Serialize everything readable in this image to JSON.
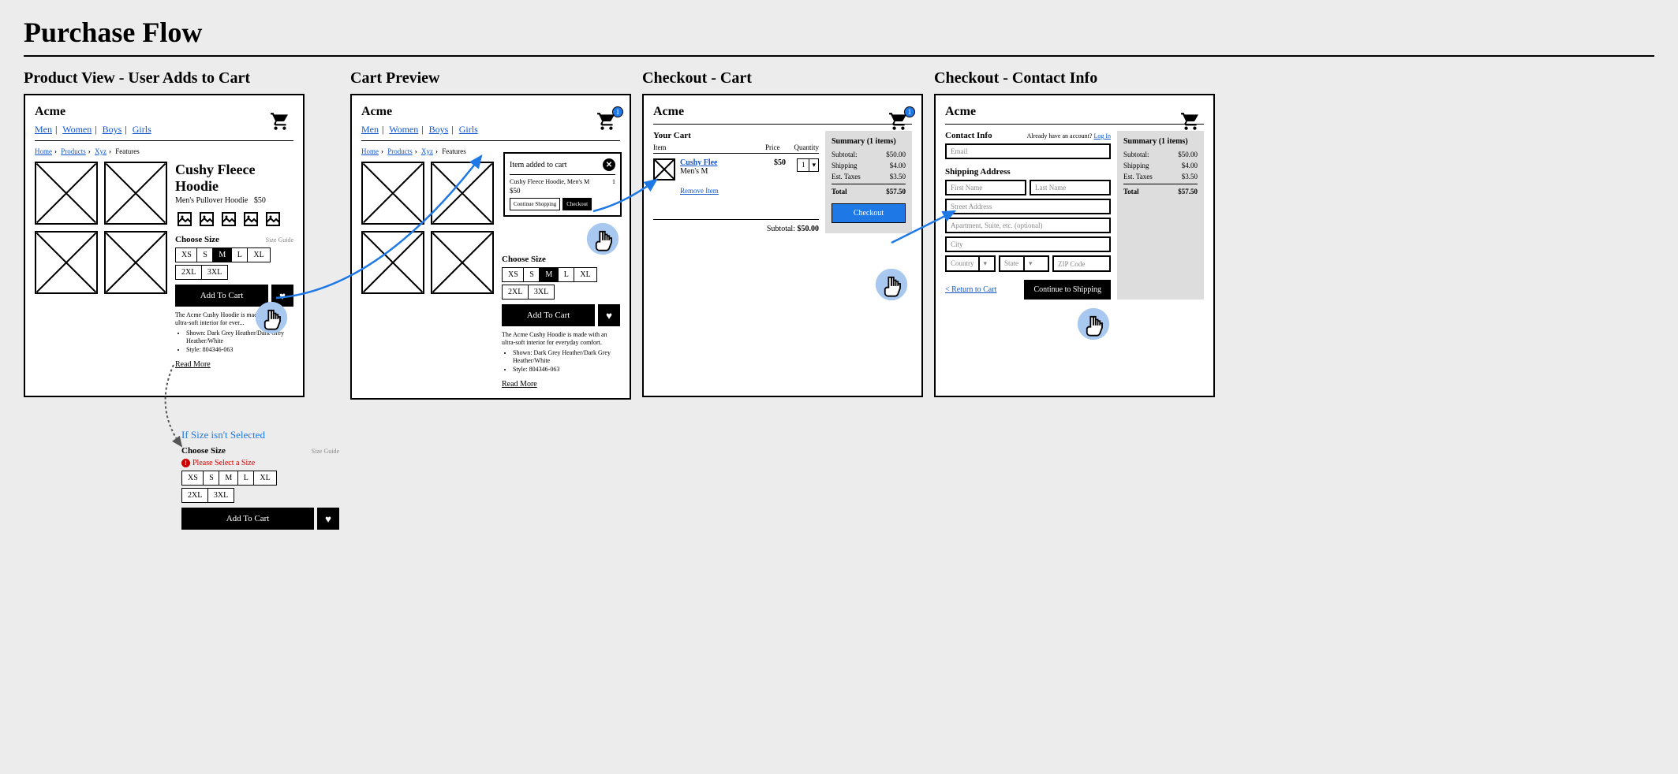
{
  "page_title": "Purchase Flow",
  "panels": {
    "p1": {
      "title": "Product View - User Adds to Cart"
    },
    "p2": {
      "title": "Cart Preview"
    },
    "p3": {
      "title": "Checkout - Cart"
    },
    "p4": {
      "title": "Checkout - Contact Info"
    }
  },
  "brand": "Acme",
  "nav": {
    "men": "Men",
    "women": "Women",
    "boys": "Boys",
    "girls": "Girls"
  },
  "crumbs": {
    "home": "Home",
    "products": "Products",
    "xyz": "Xyz",
    "features": "Features"
  },
  "product": {
    "name": "Cushy Fleece Hoodie",
    "sub": "Men's Pullover Hoodie",
    "price": "$50",
    "choose_size": "Choose Size",
    "size_guide": "Size Guide",
    "sizes": {
      "xs": "XS",
      "s": "S",
      "m": "M",
      "l": "L",
      "xl": "XL",
      "xxl": "2XL",
      "xxxl": "3XL"
    },
    "add_to_cart": "Add To Cart",
    "desc": "The Acme Cushy Hoodie is made with an ultra-soft interior for everyday comfort.",
    "desc_trunc": "The Acme Cushy Hoodie is made with an ultra-soft interior for ever...",
    "bullet1": "Shown: Dark Grey Heather/Dark Grey Heather/White",
    "bullet2": "Style: 804346-063",
    "read_more": "Read More"
  },
  "popover": {
    "title": "Item added to cart",
    "item": "Cushy Fleece Hoodie, Men's M",
    "price": "$50",
    "qty": "1",
    "continue": "Continue Shopping",
    "checkout": "Checkout"
  },
  "cart": {
    "your_cart": "Your Cart",
    "col_item": "Item",
    "col_price": "Price",
    "col_qty": "Quantity",
    "item_name": "Cushy Flee",
    "item_variant": "Men's M",
    "item_price": "$50",
    "item_qty": "1",
    "remove": "Remove Item",
    "subtotal_label": "Subtotal:",
    "subtotal_value": "$50.00"
  },
  "summary": {
    "title": "Summary (1 items)",
    "subtotal_label": "Subtotal:",
    "subtotal": "$50.00",
    "shipping_label": "Shipping",
    "shipping": "$4.00",
    "taxes_label": "Est. Taxes",
    "taxes": "$3.50",
    "total_label": "Total",
    "total": "$57.50",
    "checkout": "Checkout"
  },
  "contact": {
    "heading": "Contact Info",
    "already": "Already have an account?",
    "login": "Log In",
    "email": "Email",
    "shipping_heading": "Shipping Address",
    "first": "First Name",
    "last": "Last Name",
    "street": "Street Address",
    "apt": "Apartment, Suite, etc. (optional)",
    "city": "City",
    "country": "Country",
    "state": "State",
    "zip": "ZIP Code",
    "return": "< Return to Cart",
    "continue": "Continue to Shipping"
  },
  "error": {
    "title": "If Size isn't Selected",
    "msg": "Please Select a Size"
  },
  "badge": "1"
}
